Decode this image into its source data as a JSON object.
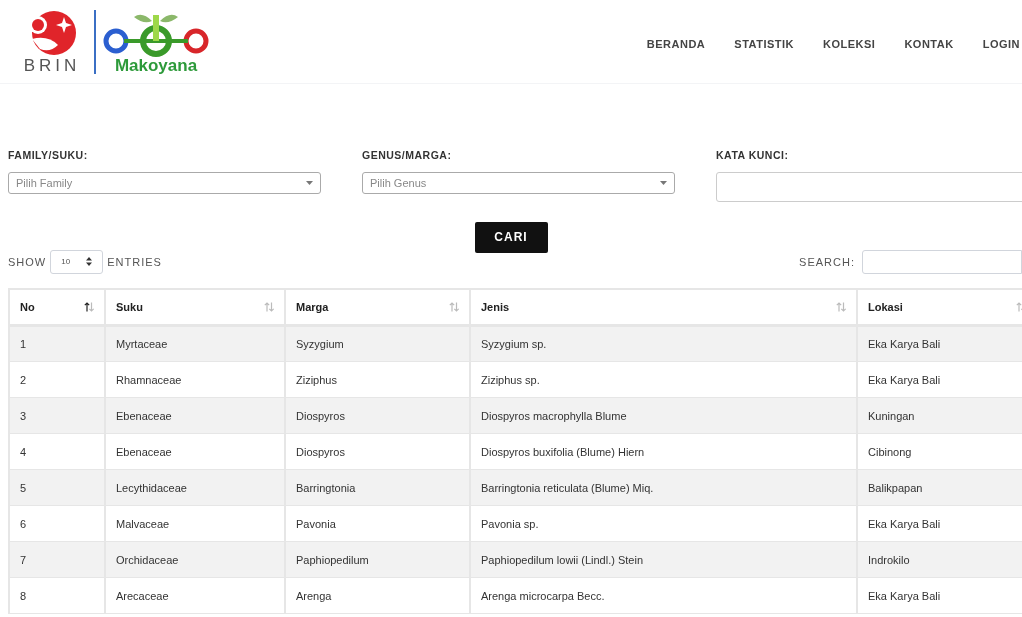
{
  "logo": {
    "left_text": "BRIN",
    "right_text": "Makoyana"
  },
  "nav": [
    {
      "label": "BERANDA"
    },
    {
      "label": "STATISTIK"
    },
    {
      "label": "KOLEKSI"
    },
    {
      "label": "KONTAK"
    },
    {
      "label": "LOGIN"
    }
  ],
  "filters": [
    {
      "kind": "select",
      "label": "FAMILY/SUKU:",
      "placeholder": "Pilih Family"
    },
    {
      "kind": "select",
      "label": "GENUS/MARGA:",
      "placeholder": "Pilih Genus"
    },
    {
      "kind": "text",
      "label": "KATA KUNCI:"
    }
  ],
  "search_button": "CARI",
  "length": {
    "before": "SHOW",
    "value": "10",
    "after": "ENTRIES"
  },
  "search_label": "SEARCH:",
  "table": {
    "columns": [
      {
        "label": "No",
        "sorted": true
      },
      {
        "label": "Suku",
        "sorted": false
      },
      {
        "label": "Marga",
        "sorted": false
      },
      {
        "label": "Jenis",
        "sorted": false
      },
      {
        "label": "Lokasi",
        "sorted": false
      }
    ],
    "rows": [
      [
        "1",
        "Myrtaceae",
        "Syzygium",
        "Syzygium sp.",
        "Eka Karya Bali"
      ],
      [
        "2",
        "Rhamnaceae",
        "Ziziphus",
        "Ziziphus sp.",
        "Eka Karya Bali"
      ],
      [
        "3",
        "Ebenaceae",
        "Diospyros",
        "Diospyros macrophylla Blume",
        "Kuningan"
      ],
      [
        "4",
        "Ebenaceae",
        "Diospyros",
        "Diospyros buxifolia (Blume) Hiern",
        "Cibinong"
      ],
      [
        "5",
        "Lecythidaceae",
        "Barringtonia",
        "Barringtonia reticulata (Blume) Miq.",
        "Balikpapan"
      ],
      [
        "6",
        "Malvaceae",
        "Pavonia",
        "Pavonia sp.",
        "Eka Karya Bali"
      ],
      [
        "7",
        "Orchidaceae",
        "Paphiopedilum",
        "Paphiopedilum lowii (Lindl.) Stein",
        "Indrokilo"
      ],
      [
        "8",
        "Arecaceae",
        "Arenga",
        "Arenga microcarpa Becc.",
        "Eka Karya Bali"
      ]
    ]
  }
}
